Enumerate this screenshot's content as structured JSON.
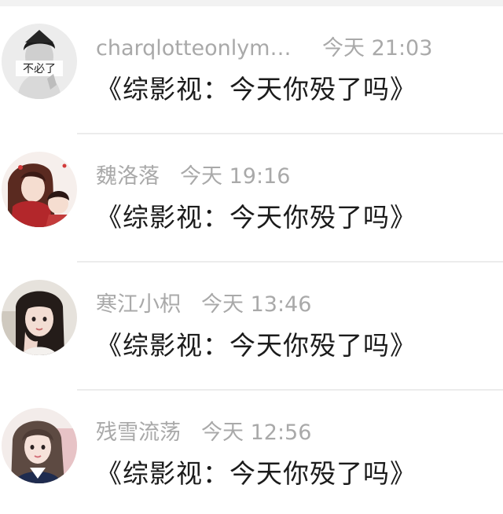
{
  "comments": [
    {
      "username": "charqlotteonlymp…",
      "time": "今天 21:03",
      "text": "《综影视：今天你殁了吗》",
      "avatar": {
        "icon": "male-grayscale-avatar",
        "caption": "不必了"
      }
    },
    {
      "username": "魏洛落",
      "time": "今天 19:16",
      "text": "《综影视：今天你殁了吗》",
      "avatar": {
        "icon": "anime-illustration-avatar"
      }
    },
    {
      "username": "寒江小枳",
      "time": "今天 13:46",
      "text": "《综影视：今天你殁了吗》",
      "avatar": {
        "icon": "girl-photo-avatar"
      }
    },
    {
      "username": "残雪流荡",
      "time": "今天 12:56",
      "text": "《综影视：今天你殁了吗》",
      "avatar": {
        "icon": "girl-uniform-avatar"
      }
    }
  ]
}
